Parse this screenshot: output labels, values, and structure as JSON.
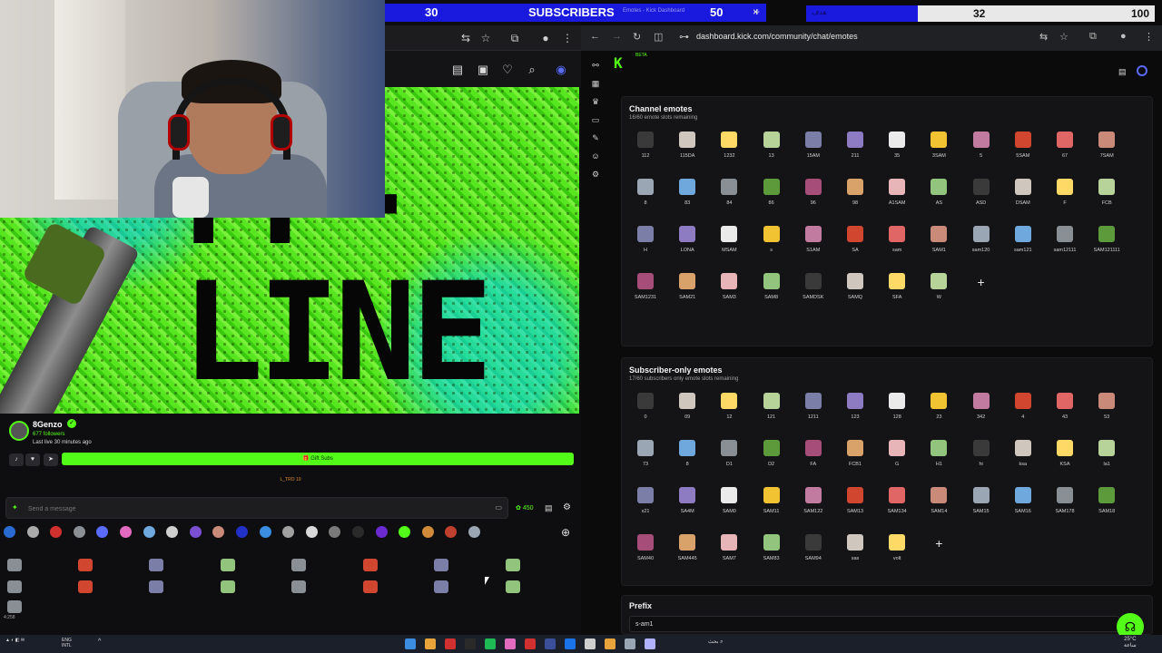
{
  "overlay": {
    "left_count": "30",
    "title": "SUBSCRIBERS",
    "right_count": "50",
    "tab_label": "Emotes - Kick Dashboard"
  },
  "goal": {
    "label": "هدف",
    "current": "32",
    "max": "100",
    "progress_fraction": 0.32,
    "fill_color": "#1a1adf"
  },
  "browser": {
    "url": "dashboard.kick.com/community/chat/emotes"
  },
  "stream": {
    "offline_line1": "FF-",
    "offline_line2": "LINE",
    "streamer_name": "8Genzo",
    "followers": "677 followers",
    "last_live": "Last live 30 minutes ago",
    "gift_subs_label": "🎁 Gift Subs",
    "pinned_text": "L_TRO 10",
    "chat_placeholder": "Send a message",
    "points": "450",
    "timestamp": "4:258"
  },
  "kick": {
    "logo": "K",
    "beta": "BETA"
  },
  "channel_emotes": {
    "title": "Channel emotes",
    "subtitle": "16/60 emote slots remaining",
    "items": [
      "112",
      "115DA",
      "1232",
      "13",
      "15AM",
      "211",
      "35",
      "3SAM",
      "5",
      "5SAM",
      "67",
      "7SAM",
      "8",
      "83",
      "84",
      "86",
      "96",
      "98",
      "A1SAM",
      "AS",
      "ASD",
      "DSAM",
      "F",
      "FCB",
      "H",
      "LONA",
      "MSAM",
      "s",
      "S1AM",
      "SA",
      "sam",
      "SAM1",
      "sam120",
      "sam121",
      "sam12111",
      "SAM121111",
      "SAM1231",
      "SAM21",
      "SAM3",
      "SAM8",
      "SAMDSK",
      "SAMQ",
      "SFA",
      "W"
    ]
  },
  "subscriber_emotes": {
    "title": "Subscriber-only emotes",
    "subtitle": "17/60 subscribers only emote slots remaining",
    "items": [
      "0",
      "09",
      "12",
      "121",
      "1211",
      "123",
      "128",
      "23",
      "342",
      "4",
      "43",
      "53",
      "73",
      "8",
      "D1",
      "D2",
      "FA",
      "FCB1",
      "G",
      "H1",
      "hi",
      "ksa",
      "KSA",
      "la1",
      "s21",
      "SA4M",
      "SAM0",
      "SAM11",
      "SAM122",
      "SAM13",
      "SAM134",
      "SAM14",
      "SAM15",
      "SAM16",
      "SAM178",
      "SAM18",
      "SAM40",
      "SAM445",
      "SAM7",
      "SAM83",
      "SAM94",
      "sas",
      "volt"
    ]
  },
  "prefix": {
    "title": "Prefix",
    "value": "s-am1"
  },
  "taskbar": {
    "lang_1": "ENG",
    "lang_2": "INTL",
    "search_label": "بحث",
    "time": "25°C",
    "date": "ساعة"
  }
}
